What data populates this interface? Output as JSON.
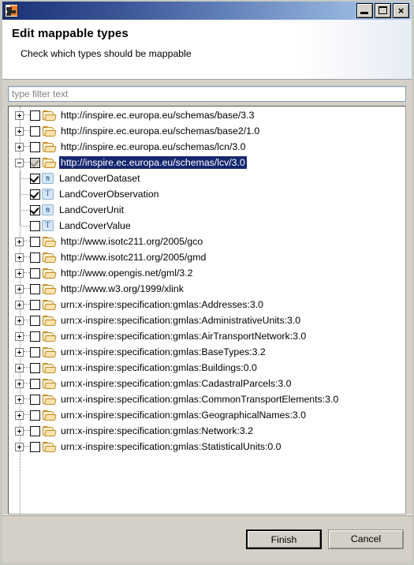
{
  "window": {
    "app_icon": "eclipse-wizard-icon",
    "controls": {
      "minimize": "_",
      "maximize": "□",
      "close": "×"
    }
  },
  "header": {
    "title": "Edit mappable types",
    "subtitle": "Check which types should be mappable"
  },
  "filter": {
    "value": "",
    "placeholder": "type filter text"
  },
  "tree": {
    "rows": [
      {
        "kind": "root",
        "expander": "plus",
        "check": "unchecked",
        "icon": "folder-icon",
        "label": "http://inspire.ec.europa.eu/schemas/base/3.3",
        "selected": false
      },
      {
        "kind": "root",
        "expander": "plus",
        "check": "unchecked",
        "icon": "folder-icon",
        "label": "http://inspire.ec.europa.eu/schemas/base2/1.0",
        "selected": false
      },
      {
        "kind": "root",
        "expander": "plus",
        "check": "unchecked",
        "icon": "folder-icon",
        "label": "http://inspire.ec.europa.eu/schemas/lcn/3.0",
        "selected": false
      },
      {
        "kind": "root",
        "expander": "minus",
        "check": "grayed",
        "icon": "folder-icon",
        "label": "http://inspire.ec.europa.eu/schemas/lcv/3.0",
        "selected": true
      },
      {
        "kind": "child",
        "check": "checked",
        "icon": "feature-type-icon",
        "badge": "ft",
        "label": "LandCoverDataset",
        "last": false
      },
      {
        "kind": "child",
        "check": "checked",
        "icon": "type-icon",
        "badge": "T",
        "label": "LandCoverObservation",
        "last": false
      },
      {
        "kind": "child",
        "check": "checked",
        "icon": "feature-type-icon",
        "badge": "ft",
        "label": "LandCoverUnit",
        "last": false
      },
      {
        "kind": "child",
        "check": "unchecked",
        "icon": "type-icon",
        "badge": "T",
        "label": "LandCoverValue",
        "last": true
      },
      {
        "kind": "root",
        "expander": "plus",
        "check": "unchecked",
        "icon": "folder-icon",
        "label": "http://www.isotc211.org/2005/gco",
        "selected": false
      },
      {
        "kind": "root",
        "expander": "plus",
        "check": "unchecked",
        "icon": "folder-icon",
        "label": "http://www.isotc211.org/2005/gmd",
        "selected": false
      },
      {
        "kind": "root",
        "expander": "plus",
        "check": "unchecked",
        "icon": "folder-icon",
        "label": "http://www.opengis.net/gml/3.2",
        "selected": false
      },
      {
        "kind": "root",
        "expander": "plus",
        "check": "unchecked",
        "icon": "folder-icon",
        "label": "http://www.w3.org/1999/xlink",
        "selected": false
      },
      {
        "kind": "root",
        "expander": "plus",
        "check": "unchecked",
        "icon": "folder-icon",
        "label": "urn:x-inspire:specification:gmlas:Addresses:3.0",
        "selected": false
      },
      {
        "kind": "root",
        "expander": "plus",
        "check": "unchecked",
        "icon": "folder-icon",
        "label": "urn:x-inspire:specification:gmlas:AdministrativeUnits:3.0",
        "selected": false
      },
      {
        "kind": "root",
        "expander": "plus",
        "check": "unchecked",
        "icon": "folder-icon",
        "label": "urn:x-inspire:specification:gmlas:AirTransportNetwork:3.0",
        "selected": false
      },
      {
        "kind": "root",
        "expander": "plus",
        "check": "unchecked",
        "icon": "folder-icon",
        "label": "urn:x-inspire:specification:gmlas:BaseTypes:3.2",
        "selected": false
      },
      {
        "kind": "root",
        "expander": "plus",
        "check": "unchecked",
        "icon": "folder-icon",
        "label": "urn:x-inspire:specification:gmlas:Buildings:0.0",
        "selected": false
      },
      {
        "kind": "root",
        "expander": "plus",
        "check": "unchecked",
        "icon": "folder-icon",
        "label": "urn:x-inspire:specification:gmlas:CadastralParcels:3.0",
        "selected": false
      },
      {
        "kind": "root",
        "expander": "plus",
        "check": "unchecked",
        "icon": "folder-icon",
        "label": "urn:x-inspire:specification:gmlas:CommonTransportElements:3.0",
        "selected": false
      },
      {
        "kind": "root",
        "expander": "plus",
        "check": "unchecked",
        "icon": "folder-icon",
        "label": "urn:x-inspire:specification:gmlas:GeographicalNames:3.0",
        "selected": false
      },
      {
        "kind": "root",
        "expander": "plus",
        "check": "unchecked",
        "icon": "folder-icon",
        "label": "urn:x-inspire:specification:gmlas:Network:3.2",
        "selected": false
      },
      {
        "kind": "root",
        "expander": "plus",
        "check": "unchecked",
        "icon": "folder-icon",
        "label": "urn:x-inspire:specification:gmlas:StatisticalUnits:0.0",
        "selected": false
      }
    ]
  },
  "footer": {
    "finish_label": "Finish",
    "cancel_label": "Cancel"
  },
  "colors": {
    "selection": "#16276F",
    "titlebar_dark": "#1C3474",
    "titlebar_light": "#B9D0EE",
    "dialog_bg": "#D4D0C8",
    "badge_blue": "#3C6D9E"
  }
}
